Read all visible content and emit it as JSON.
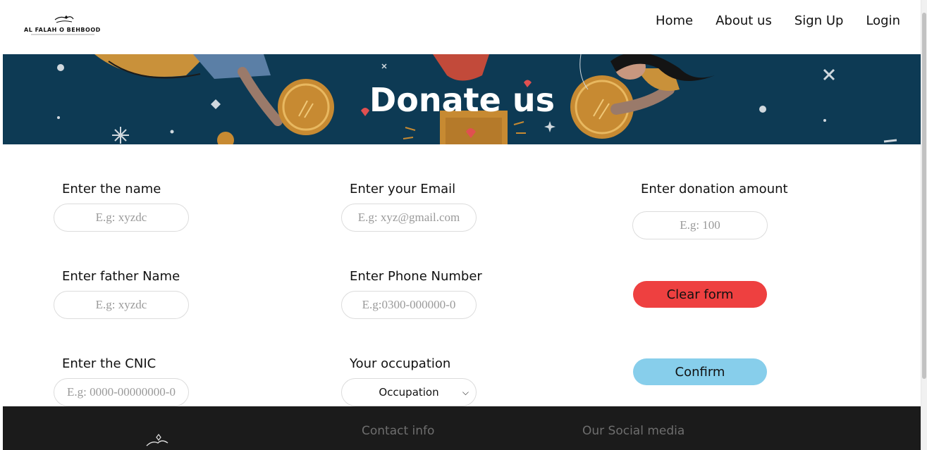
{
  "brand": {
    "name": "AL FALAH O BEHBOOD",
    "icon": "hands-heart-logo"
  },
  "nav": {
    "items": [
      {
        "label": "Home"
      },
      {
        "label": "About us"
      },
      {
        "label": "Sign Up"
      },
      {
        "label": "Login"
      }
    ]
  },
  "hero": {
    "title": "Donate us"
  },
  "form": {
    "name": {
      "label": "Enter the name",
      "placeholder": "E.g: xyzdc"
    },
    "father_name": {
      "label": "Enter father Name",
      "placeholder": "E.g: xyzdc"
    },
    "cnic": {
      "label": "Enter the CNIC",
      "placeholder": "E.g: 0000-00000000-0"
    },
    "email": {
      "label": "Enter your Email",
      "placeholder": "E.g: xyz@gmail.com"
    },
    "phone": {
      "label": "Enter Phone Number",
      "placeholder": "E.g:0300-000000-0"
    },
    "occupation": {
      "label": "Your occupation",
      "selected": "Occupation"
    },
    "amount": {
      "label": "Enter donation amount",
      "placeholder": "E.g: 100"
    },
    "clear_label": "Clear form",
    "confirm_label": "Confirm"
  },
  "footer": {
    "contact_heading": "Contact info",
    "social_heading": "Our Social media"
  },
  "colors": {
    "hero_bg": "#0d3a54",
    "clear_button": "#ee4040",
    "confirm_button": "#87ceeb",
    "footer_bg": "#1b1b1b"
  }
}
